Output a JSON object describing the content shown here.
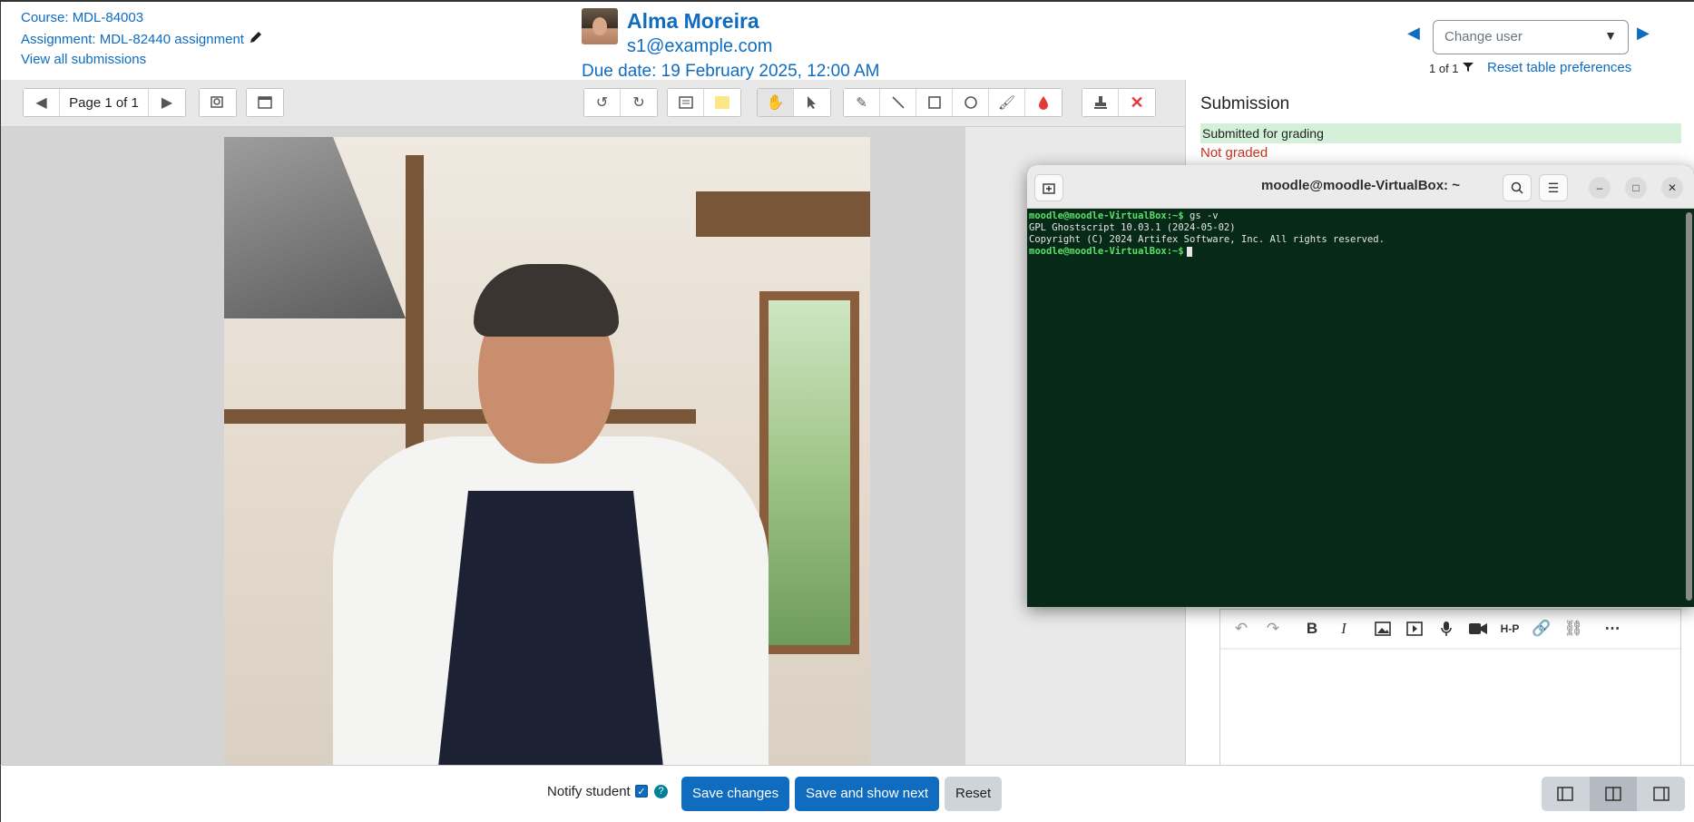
{
  "header": {
    "course": "Course: MDL-84003",
    "assignment": "Assignment: MDL-82440 assignment",
    "view_all": "View all submissions",
    "user_name": "Alma Moreira",
    "user_email": "s1@example.com",
    "due_date": "Due date: 19 February 2025, 12:00 AM",
    "change_user_placeholder": "Change user",
    "page_count": "1 of 1",
    "reset_prefs": "Reset table preferences"
  },
  "toolbar": {
    "page_info": "Page 1 of 1"
  },
  "panel": {
    "title": "Submission",
    "status_submitted": "Submitted for grading",
    "status_grade": "Not graded"
  },
  "terminal": {
    "title": "moodle@moodle-VirtualBox: ~",
    "lines": [
      {
        "prompt": "moodle@moodle-VirtualBox:~$",
        "text": " gs -v"
      },
      {
        "prompt": "",
        "text": "GPL Ghostscript 10.03.1 (2024-05-02)"
      },
      {
        "prompt": "",
        "text": "Copyright (C) 2024 Artifex Software, Inc.  All rights reserved."
      },
      {
        "prompt": "moodle@moodle-VirtualBox:~$",
        "text": ""
      }
    ]
  },
  "footer": {
    "notify_label": "Notify student",
    "save": "Save changes",
    "save_next": "Save and show next",
    "reset": "Reset"
  },
  "colors": {
    "link": "#0f6cbf",
    "terminal_bg": "#072a18",
    "prompt": "#5be067",
    "submitted_bg": "#d4f0d8",
    "not_graded": "#ca3120"
  }
}
